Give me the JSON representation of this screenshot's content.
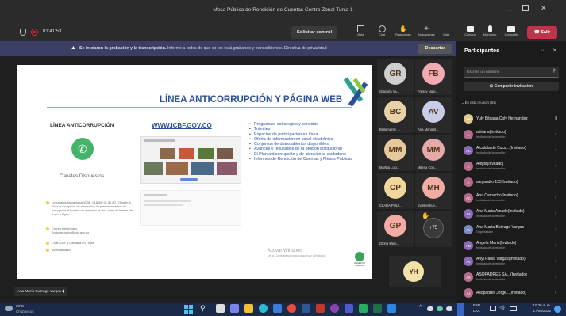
{
  "window": {
    "title": "Mesa Pública de Rendición de Cuentas Centro Zonal Tunja 1"
  },
  "meeting": {
    "timer": "01:41:53",
    "request_control": "Solicitar control",
    "tools": [
      "Vista",
      "Chat",
      "Reacciones",
      "Aplicaciones",
      "Más"
    ],
    "right_tools": [
      "Cámara",
      "Micrófono",
      "Compartir"
    ],
    "leave": "Salir"
  },
  "banner": {
    "bold": "Se iniciaron la grabación y la transcripción.",
    "text": "Informe a todos de que se les está grabando y transcribiendo. Directiva de privacidad",
    "dismiss": "Descartar"
  },
  "slide": {
    "title": "LÍNEA ANTICORRUPCIÓN Y PÁGINA WEB",
    "left_heading": "LÍNEA ANTICORRUPCIÓN",
    "left_caption": "Canales Dispuestos",
    "middle_heading": "WWW.ICBF.GOV.CO",
    "bullets": [
      "Programas, estrategias y servicios",
      "Trámites",
      "Espacios de participación en línea",
      "Oferta de información en canal electrónico",
      "Conjuntos de datos abiertos disponibles",
      "Avances y resultados de la gestión institucional",
      "El Plan anticorrupción y de atención al ciudadano",
      "Informes de Rendición de Cuentas y Mesas Públicas"
    ],
    "channels": [
      "Línea gratuita nacional ICBF: 018000 91 80 80 - Opción 4. Para la recepción de denuncias de presuntos actos de corrupción el horario de atención es de Lunes a Viernes de 8 am a 5 pm.",
      "Correo electrónico: Anticorrupcion@icbf.gov.co",
      "Chat ICBF y Llamada en Línea",
      "Videollamada"
    ],
    "logo_text": "BIENESTAR FAMILIAR",
    "watermark_1": "Activar Windows",
    "watermark_2": "Ve a Configuración para activar Windows."
  },
  "presenter": "Ana María Buitrago Vargas",
  "tiles": [
    {
      "initials": "GR",
      "name": "Graciela Va...",
      "color": "#cfcfcf"
    },
    {
      "initials": "FB",
      "name": "Fressy Nate...",
      "color": "#f2aab3"
    },
    {
      "initials": "BC",
      "name": "Bellamente ...",
      "color": "#e8d2a8"
    },
    {
      "initials": "AV",
      "name": "Ana Maria B...",
      "color": "#c9cde8"
    },
    {
      "initials": "MM",
      "name": "Martha Luci...",
      "color": "#e6c89b"
    },
    {
      "initials": "MM",
      "name": "Milena Con...",
      "color": "#e5a9a9"
    },
    {
      "initials": "CP",
      "name": "CLARA PULI...",
      "color": "#f0d79b"
    },
    {
      "initials": "MH",
      "name": "maribel hue...",
      "color": "#f2aca3"
    },
    {
      "initials": "GP",
      "name": "Gloria Merc...",
      "color": "#f2aca3"
    },
    {
      "initials": "+75",
      "name": "",
      "color": "#3a3a3a"
    }
  ],
  "self_tile": {
    "initials": "YH"
  },
  "participants": {
    "title": "Participantes",
    "search_placeholder": "Escribe un nombre",
    "share_invite": "Compartir invitación",
    "section": "En esta reunión (81)",
    "list": [
      {
        "initials": "YH",
        "name": "Yuly Bibiana Coly Hernandez",
        "tag": "",
        "sub": "",
        "color": "#e3c88e"
      },
      {
        "initials": "A",
        "name": "adriana",
        "tag": "(Invitado)",
        "sub": "Invitado de la reunión",
        "color": "#b46a8a"
      },
      {
        "initials": "AC",
        "name": "Alcaldía de Cuca...",
        "tag": "(Invitado)",
        "sub": "Invitado de la reunión",
        "color": "#8a6ab4"
      },
      {
        "initials": "A",
        "name": "Alejita",
        "tag": "(Invitado)",
        "sub": "Invitado de la reunión",
        "color": "#b46a8a"
      },
      {
        "initials": "A",
        "name": "aleyandro 135",
        "tag": "(Invitado)",
        "sub": "",
        "color": "#b46a8a"
      },
      {
        "initials": "AC",
        "name": "Ana Camacho",
        "tag": "(Invitado)",
        "sub": "Invitado de la reunión",
        "color": "#b46a8a"
      },
      {
        "initials": "AA",
        "name": "Ana Maria Amado",
        "tag": "(Invitado)",
        "sub": "Invitado de la reunión",
        "color": "#8a6ab4"
      },
      {
        "initials": "AV",
        "name": "Ana María Buitrago Vargas",
        "tag": "",
        "sub": "Organizador",
        "color": "#7a8ac4"
      },
      {
        "initials": "AM",
        "name": "Angela Maria",
        "tag": "(Invitado)",
        "sub": "Invitado de la reunión",
        "color": "#8a6ab4"
      },
      {
        "initials": "AV",
        "name": "Anyi Paola Vargas",
        "tag": "(Invitado)",
        "sub": "Invitado de la reunión",
        "color": "#8a6ab4"
      },
      {
        "initials": "AS",
        "name": "ASOPADRES SA...",
        "tag": "(Invitado)",
        "sub": "Invitado de la reunión",
        "color": "#b46a8a"
      },
      {
        "initials": "AJ",
        "name": "Asopadres Jorge...",
        "tag": "(Invitado)",
        "sub": "",
        "color": "#b46a8a"
      }
    ]
  },
  "taskbar": {
    "weather_temp": "29°C",
    "weather_desc": "Chubascos",
    "lang": "ESP",
    "lang2": "LAA",
    "time": "10:26 a. m.",
    "date": "17/05/2022"
  }
}
